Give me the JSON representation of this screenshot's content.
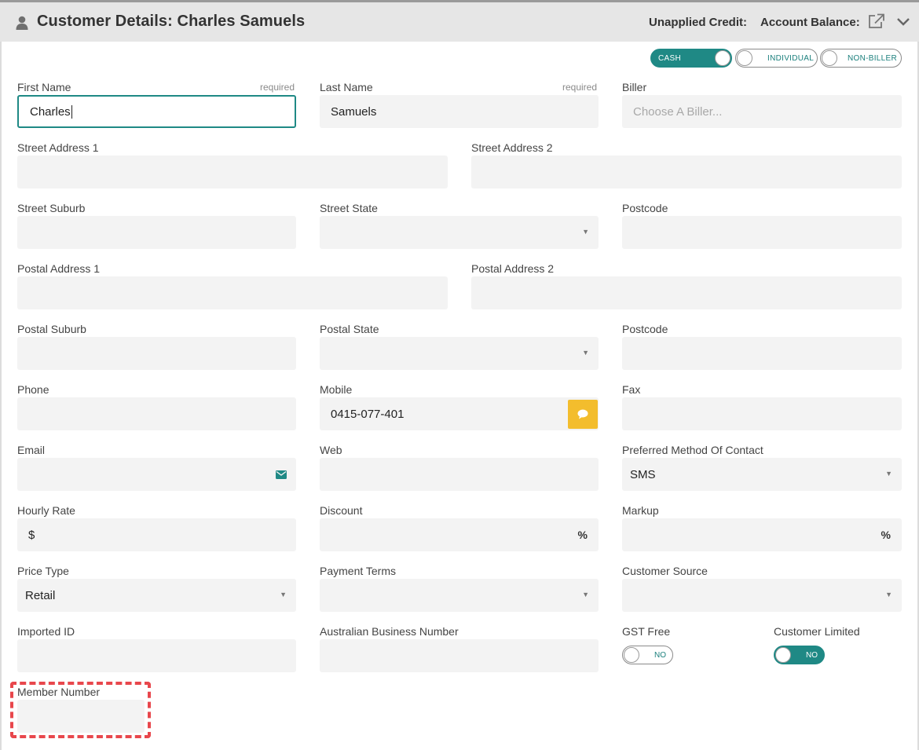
{
  "header": {
    "title": "Customer Details:",
    "name": "Charles Samuels",
    "unapplied_credit": "Unapplied Credit:",
    "account_balance": "Account Balance:"
  },
  "customer_type": {
    "cash": "CASH",
    "individual": "INDIVIDUAL",
    "non_biller": "NON-BILLER",
    "selected": "CASH"
  },
  "required_label": "required",
  "fields": {
    "first_name": {
      "label": "First Name",
      "value": "Charles"
    },
    "last_name": {
      "label": "Last Name",
      "value": "Samuels"
    },
    "biller": {
      "label": "Biller",
      "placeholder": "Choose A Biller..."
    },
    "street_address_1": {
      "label": "Street Address 1"
    },
    "street_address_2": {
      "label": "Street Address 2"
    },
    "street_suburb": {
      "label": "Street Suburb"
    },
    "street_state": {
      "label": "Street State"
    },
    "street_postcode": {
      "label": "Postcode"
    },
    "postal_address_1": {
      "label": "Postal Address 1"
    },
    "postal_address_2": {
      "label": "Postal Address 2"
    },
    "postal_suburb": {
      "label": "Postal Suburb"
    },
    "postal_state": {
      "label": "Postal State"
    },
    "postal_postcode": {
      "label": "Postcode"
    },
    "phone": {
      "label": "Phone"
    },
    "mobile": {
      "label": "Mobile",
      "value": "0415-077-401"
    },
    "fax": {
      "label": "Fax"
    },
    "email": {
      "label": "Email"
    },
    "web": {
      "label": "Web"
    },
    "preferred_contact": {
      "label": "Preferred Method Of Contact",
      "value": "SMS"
    },
    "hourly_rate": {
      "label": "Hourly Rate",
      "prefix": "$"
    },
    "discount": {
      "label": "Discount",
      "suffix": "%"
    },
    "markup": {
      "label": "Markup",
      "suffix": "%"
    },
    "price_type": {
      "label": "Price Type",
      "value": "Retail"
    },
    "payment_terms": {
      "label": "Payment Terms"
    },
    "customer_source": {
      "label": "Customer Source"
    },
    "imported_id": {
      "label": "Imported ID"
    },
    "abn": {
      "label": "Australian Business Number"
    },
    "gst_free": {
      "label": "GST Free",
      "toggle": "NO",
      "on": false
    },
    "customer_limited": {
      "label": "Customer Limited",
      "toggle": "NO",
      "on": true
    },
    "member_number": {
      "label": "Member Number"
    }
  },
  "colors": {
    "accent": "#1f8985",
    "sms_button": "#f3bd2d",
    "highlight": "#e8474c"
  },
  "icons": [
    "user-icon",
    "external-link-icon",
    "chevron-down-icon",
    "chat-bubble-icon",
    "envelope-icon"
  ]
}
